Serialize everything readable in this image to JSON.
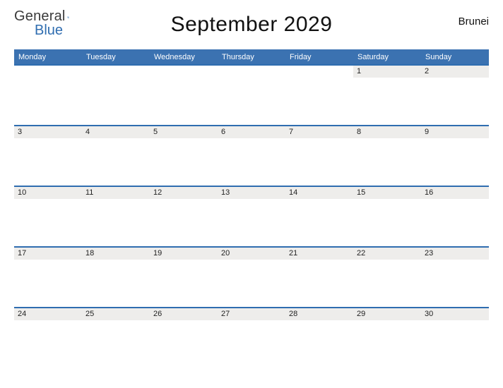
{
  "brand": {
    "word1": "Genera",
    "word1_last": "l",
    "word2": "Blue"
  },
  "title": "September 2029",
  "region": "Brunei",
  "days": [
    "Monday",
    "Tuesday",
    "Wednesday",
    "Thursday",
    "Friday",
    "Saturday",
    "Sunday"
  ],
  "weeks": [
    [
      "",
      "",
      "",
      "",
      "",
      "1",
      "2"
    ],
    [
      "3",
      "4",
      "5",
      "6",
      "7",
      "8",
      "9"
    ],
    [
      "10",
      "11",
      "12",
      "13",
      "14",
      "15",
      "16"
    ],
    [
      "17",
      "18",
      "19",
      "20",
      "21",
      "22",
      "23"
    ],
    [
      "24",
      "25",
      "26",
      "27",
      "28",
      "29",
      "30"
    ]
  ]
}
